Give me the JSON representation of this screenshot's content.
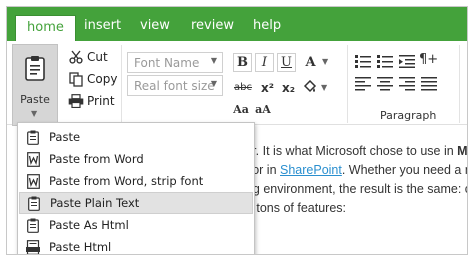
{
  "tabs": [
    {
      "label": "home",
      "active": true
    },
    {
      "label": "insert",
      "active": false
    },
    {
      "label": "view",
      "active": false
    },
    {
      "label": "review",
      "active": false
    },
    {
      "label": "help",
      "active": false
    }
  ],
  "clipboard": {
    "paste_label": "Paste",
    "cut_label": "Cut",
    "copy_label": "Copy",
    "print_label": "Print"
  },
  "font": {
    "name_placeholder": "Font Name",
    "size_placeholder": "Real font size"
  },
  "format": {
    "bold": "B",
    "italic": "I",
    "underline": "U",
    "font_color": "A",
    "strike": "abc",
    "superscript": "x²",
    "subscript": "x₂",
    "grow_font": "Aa",
    "shrink_font": "aA"
  },
  "paragraph": {
    "label": "Paragraph"
  },
  "content": {
    "line1_text": "itor. It is what Microsoft chose to use in ",
    "line1_bold": "M",
    "line2_text": "ditor in ",
    "line2_link": "SharePoint",
    "line2_rest": ". Whether you need a m",
    "line3_text": "ring environment, the result is the same: c",
    "line4_text": "nd tons of features:"
  },
  "paste_menu": [
    {
      "label": "Paste",
      "icon": "clipboard-icon",
      "highlighted": false
    },
    {
      "label": "Paste from Word",
      "icon": "word-icon",
      "highlighted": false
    },
    {
      "label": "Paste from Word, strip font",
      "icon": "word-icon",
      "highlighted": false
    },
    {
      "label": "Paste Plain Text",
      "icon": "clipboard-icon",
      "highlighted": true
    },
    {
      "label": "Paste As Html",
      "icon": "clipboard-icon",
      "highlighted": false
    },
    {
      "label": "Paste Html",
      "icon": "html-icon",
      "highlighted": false
    }
  ],
  "colors": {
    "accent": "#44a23b",
    "link": "#2a8fcf",
    "highlight": "#e2e2e2"
  }
}
